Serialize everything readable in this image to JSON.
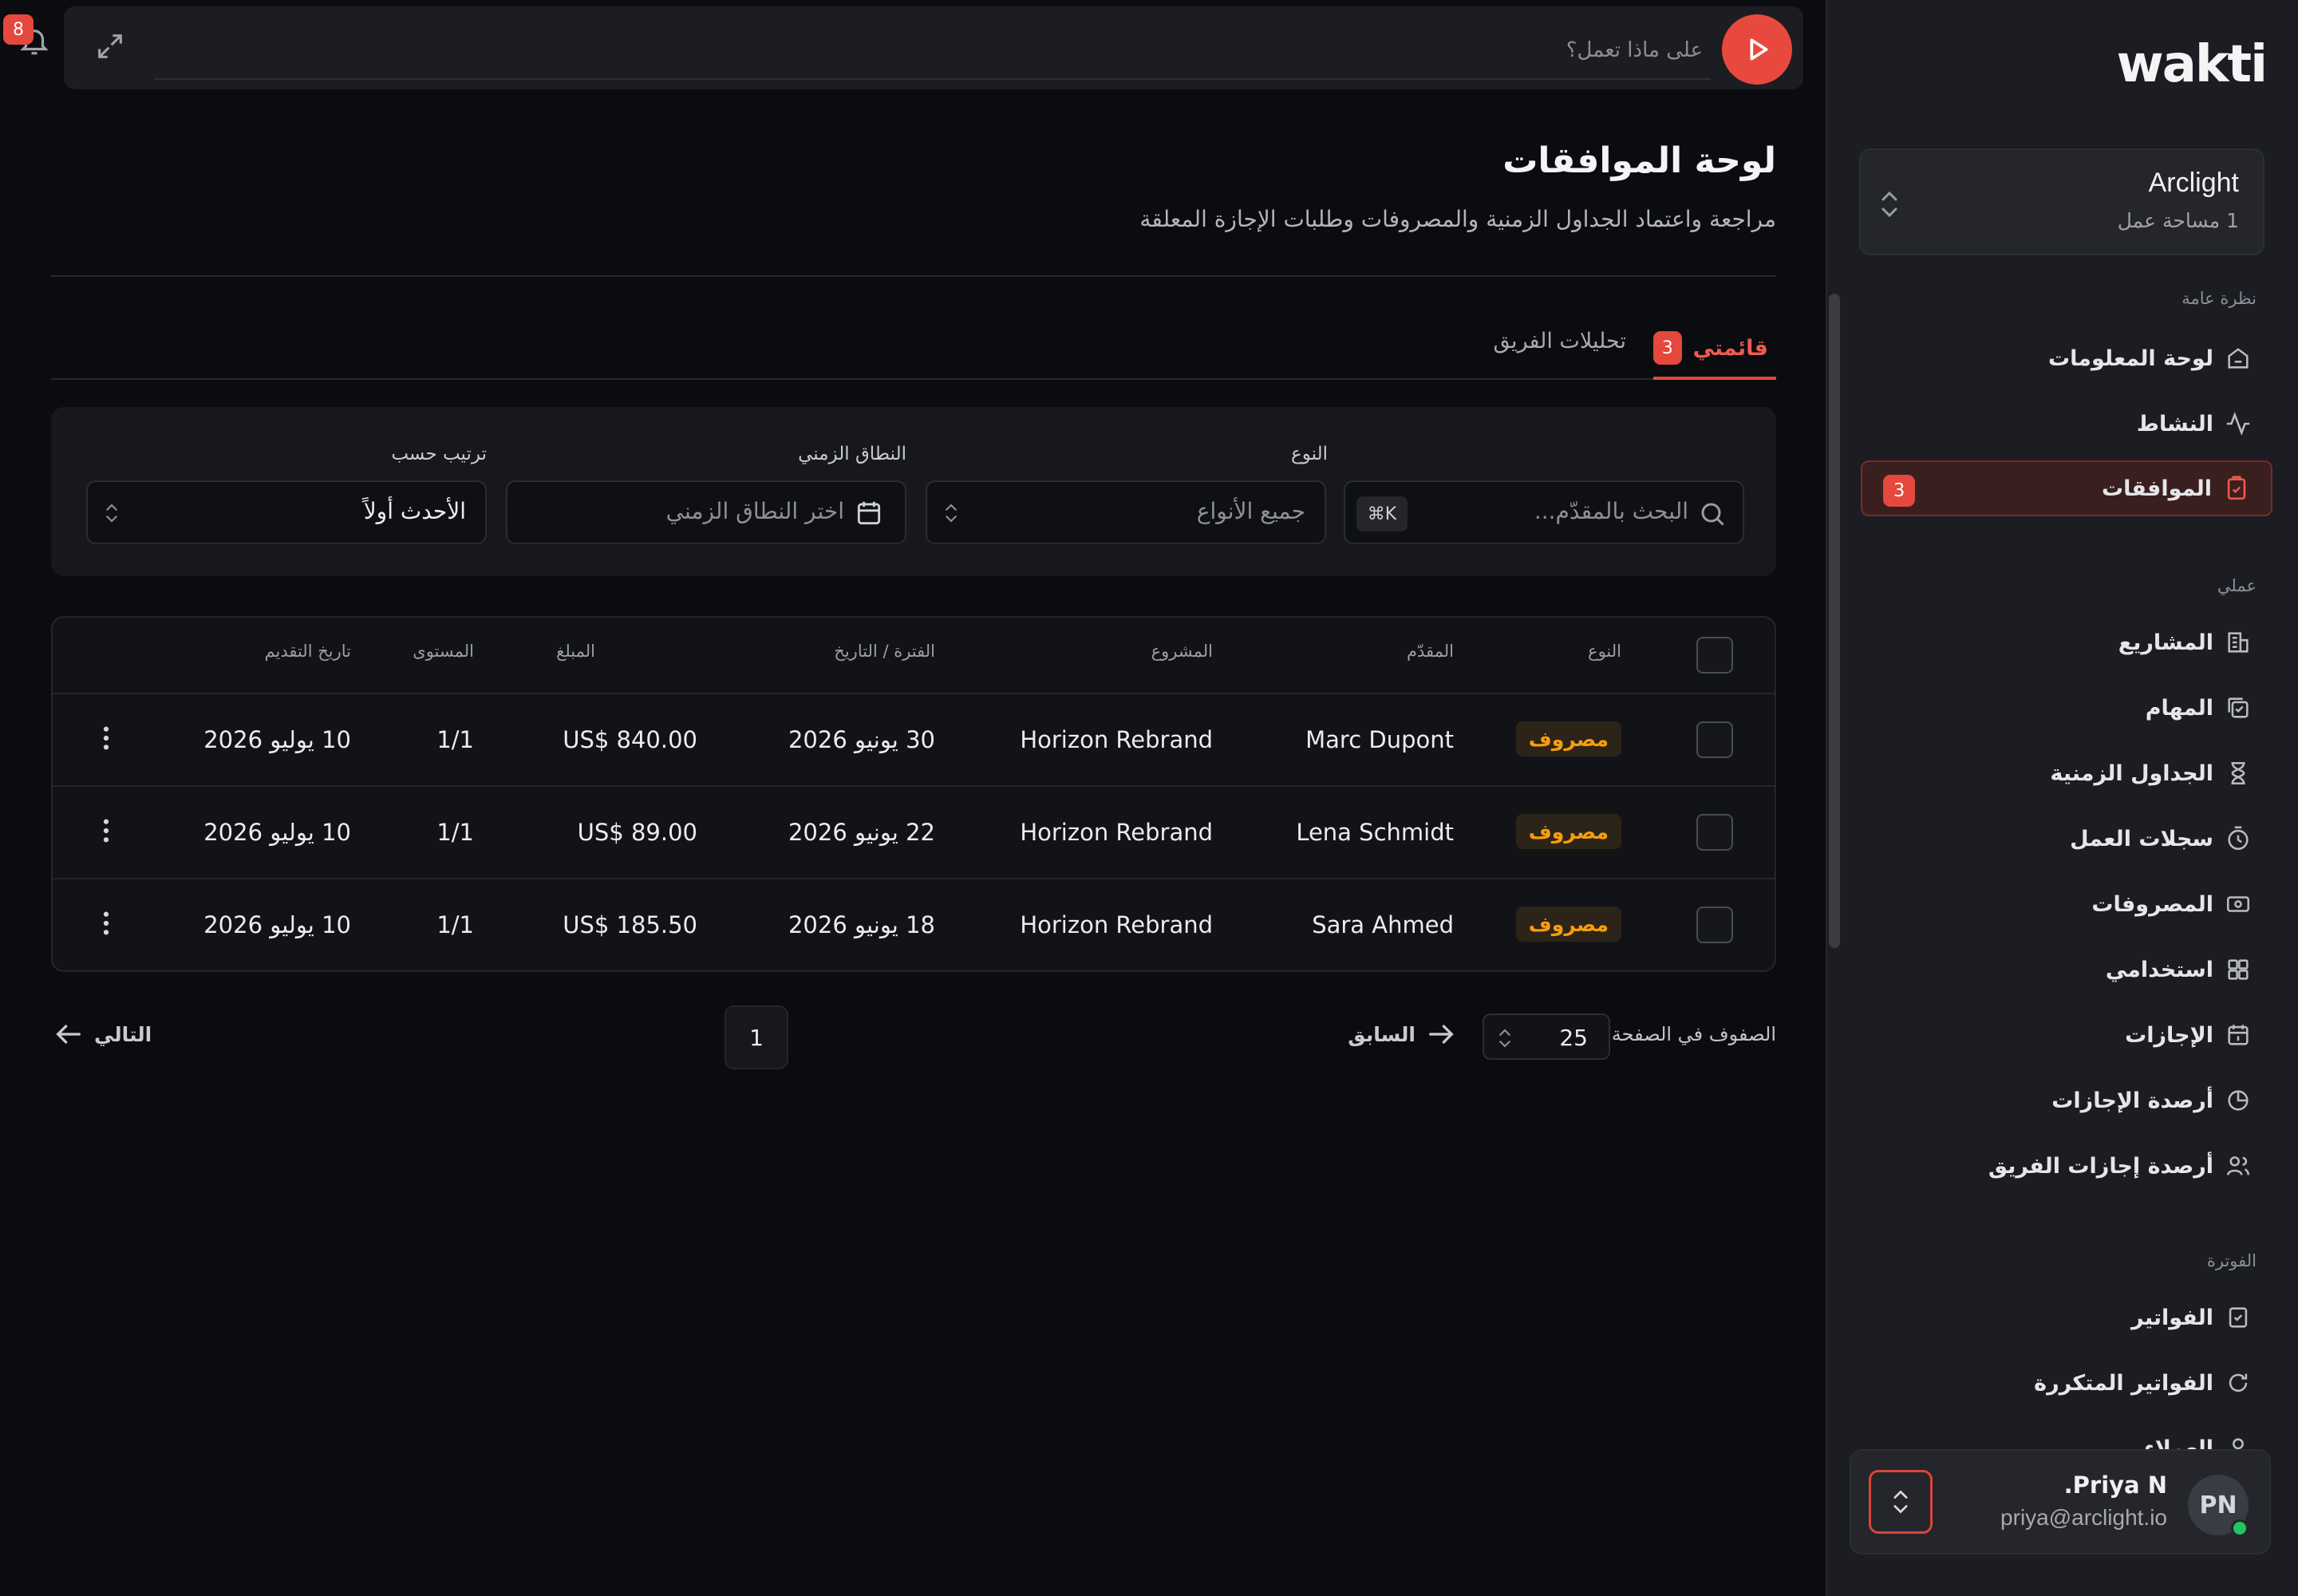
{
  "brand": {
    "logo": "wakti"
  },
  "workspace": {
    "name": "Arclight",
    "count": "1 مساحة عمل"
  },
  "sidebar": {
    "sections": [
      {
        "title": "نظرة عامة"
      },
      {
        "title": "عملي"
      },
      {
        "title": "الفوترة"
      }
    ],
    "items": [
      {
        "label": "لوحة المعلومات",
        "icon": "home-icon"
      },
      {
        "label": "النشاط",
        "icon": "activity-icon"
      },
      {
        "label": "الموافقات",
        "icon": "clipboard-check-icon",
        "badge": "3",
        "active": true
      },
      {
        "label": "المشاريع",
        "icon": "building-icon"
      },
      {
        "label": "المهام",
        "icon": "tasks-icon"
      },
      {
        "label": "الجداول الزمنية",
        "icon": "hourglass-icon"
      },
      {
        "label": "سجلات العمل",
        "icon": "timer-icon"
      },
      {
        "label": "المصروفات",
        "icon": "cash-icon"
      },
      {
        "label": "استخدامي",
        "icon": "grid-icon"
      },
      {
        "label": "الإجازات",
        "icon": "calendar-icon"
      },
      {
        "label": "أرصدة الإجازات",
        "icon": "pie-icon"
      },
      {
        "label": "أرصدة إجازات الفريق",
        "icon": "users-icon"
      },
      {
        "label": "الفواتير",
        "icon": "invoice-icon"
      },
      {
        "label": "الفواتير المتكررة",
        "icon": "refresh-icon"
      },
      {
        "label": "العملاء",
        "icon": "user-icon"
      }
    ]
  },
  "user": {
    "initials": "PN",
    "name": "Priya N.",
    "email": "priya@arclight.io"
  },
  "topbar": {
    "placeholder": "على ماذا تعمل؟",
    "notifications": "8"
  },
  "page": {
    "title": "لوحة الموافقات",
    "subtitle": "مراجعة واعتماد الجداول الزمنية والمصروفات وطلبات الإجازة المعلقة"
  },
  "tabs": {
    "mine": {
      "label": "قائمتي",
      "badge": "3"
    },
    "team": {
      "label": "تحليلات الفريق"
    }
  },
  "filters": {
    "search_placeholder": "البحث بالمقدّم...",
    "search_kbd": "⌘K",
    "type": {
      "label": "النوع",
      "value": "جميع الأنواع"
    },
    "range": {
      "label": "النطاق الزمني",
      "value": "اختر النطاق الزمني"
    },
    "sort": {
      "label": "ترتيب حسب",
      "value": "الأحدث أولاً"
    }
  },
  "table": {
    "headers": {
      "type": "النوع",
      "submitter": "المقدّم",
      "project": "المشروع",
      "period": "الفترة / التاريخ",
      "amount": "المبلغ",
      "level": "المستوى",
      "submitted": "تاريخ التقديم"
    },
    "rows": [
      {
        "type": "مصروف",
        "submitter": "Marc Dupont",
        "project": "Horizon Rebrand",
        "period": "30 يونيو 2026",
        "amount": "US$ 840.00",
        "level": "1/1",
        "submitted": "10 يوليو 2026"
      },
      {
        "type": "مصروف",
        "submitter": "Lena Schmidt",
        "project": "Horizon Rebrand",
        "period": "22 يونيو 2026",
        "amount": "US$ 89.00",
        "level": "1/1",
        "submitted": "10 يوليو 2026"
      },
      {
        "type": "مصروف",
        "submitter": "Sara Ahmed",
        "project": "Horizon Rebrand",
        "period": "18 يونيو 2026",
        "amount": "US$ 185.50",
        "level": "1/1",
        "submitted": "10 يوليو 2026"
      }
    ]
  },
  "pagination": {
    "rows_label": "الصفوف في الصفحة",
    "rows_value": "25",
    "prev": "السابق",
    "page": "1",
    "next": "التالي"
  },
  "colors": {
    "accent": "#e5483c",
    "expense_tag": "#f59e0b",
    "background": "#0b0c0f",
    "sidebar": "#1b1d22"
  }
}
